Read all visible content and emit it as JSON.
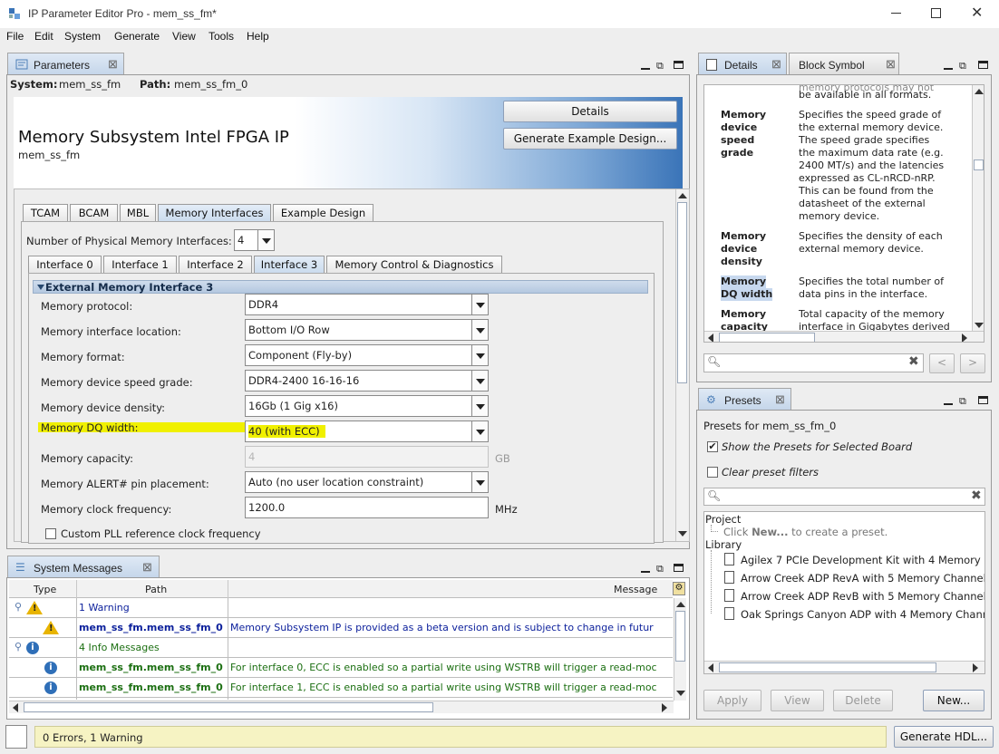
{
  "window": {
    "title": "IP Parameter Editor Pro - mem_ss_fm*"
  },
  "menu": [
    "File",
    "Edit",
    "System",
    "Generate",
    "View",
    "Tools",
    "Help"
  ],
  "parameters": {
    "tab_label": "Parameters",
    "system_label": "System:",
    "system_value": "mem_ss_fm",
    "path_label": "Path:",
    "path_value": "mem_ss_fm_0",
    "ip_title": "Memory Subsystem Intel FPGA IP",
    "ip_subtitle": "mem_ss_fm",
    "details_button": "Details",
    "generate_example_button": "Generate Example Design...",
    "tabs": [
      "TCAM",
      "BCAM",
      "MBL",
      "Memory Interfaces",
      "Example Design"
    ],
    "num_interfaces_label": "Number of Physical Memory Interfaces:",
    "num_interfaces_value": "4",
    "interface_tabs": [
      "Interface 0",
      "Interface 1",
      "Interface 2",
      "Interface 3",
      "Memory Control & Diagnostics"
    ],
    "section_title": "External Memory Interface 3",
    "fields": [
      {
        "label": "Memory protocol:",
        "value": "DDR4"
      },
      {
        "label": "Memory interface location:",
        "value": "Bottom I/O Row"
      },
      {
        "label": "Memory format:",
        "value": "Component (Fly-by)"
      },
      {
        "label": "Memory device speed grade:",
        "value": "DDR4-2400 16-16-16"
      },
      {
        "label": "Memory device density:",
        "value": "16Gb (1 Gig x16)"
      },
      {
        "label": "Memory DQ width:",
        "value": "40 (with ECC)"
      },
      {
        "label": "Memory capacity:",
        "value": "4",
        "unit": "GB"
      },
      {
        "label": "Memory ALERT# pin placement:",
        "value": "Auto (no user location constraint)"
      },
      {
        "label": "Memory clock frequency:",
        "value": "1200.0",
        "unit": "MHz"
      }
    ],
    "custom_pll_label": "Custom PLL reference clock frequency",
    "highlight_color": "#f0f000"
  },
  "details": {
    "tab_details": "Details",
    "tab_block_symbol": "Block Symbol",
    "top_fragment_1": "memory protocols may not",
    "top_fragment_2": "be available in all formats.",
    "entries": [
      {
        "term": [
          "Memory",
          "device",
          "speed",
          "grade"
        ],
        "desc": [
          "Specifies the speed grade of",
          "the external memory device.",
          "The speed grade specifies",
          "the maximum data rate (e.g.",
          "2400 MT/s) and the latencies",
          "expressed as CL-nRCD-nRP.",
          "This can be found from the",
          "datasheet of the external",
          "memory device."
        ]
      },
      {
        "term": [
          "Memory",
          "device",
          "density"
        ],
        "desc": [
          "Specifies the density of each",
          "external memory device."
        ]
      },
      {
        "term": [
          "Memory",
          "DQ width"
        ],
        "desc": [
          "Specifies the total number of",
          "data pins in the interface."
        ]
      },
      {
        "term": [
          "Memory",
          "capacity"
        ],
        "desc": [
          "Total capacity of the memory",
          "interface in Gigabytes derived"
        ]
      }
    ]
  },
  "presets": {
    "tab_label": "Presets",
    "presets_for": "Presets for mem_ss_fm_0",
    "show_presets_label": "Show the Presets for Selected Board",
    "clear_filters_label": "Clear preset filters",
    "project_label": "Project",
    "project_hint_pre": "Click ",
    "project_hint_bold": "New...",
    "project_hint_post": " to create a preset.",
    "library_label": "Library",
    "library_items": [
      "Agilex 7 PCIe Development Kit with 4 Memory C",
      "Arrow Creek ADP RevA with 5 Memory Channels",
      "Arrow Creek ADP RevB with 5 Memory Channels",
      "Oak Springs Canyon ADP with 4 Memory Chann"
    ],
    "buttons": {
      "apply": "Apply",
      "view": "View",
      "delete": "Delete",
      "new": "New..."
    }
  },
  "messages": {
    "tab_label": "System Messages",
    "col_type": "Type",
    "col_path": "Path",
    "col_message": "Message",
    "warning_group": "1 Warning",
    "info_group": "4 Info Messages",
    "rows": [
      {
        "path": "mem_ss_fm.mem_ss_fm_0",
        "message": "Memory Subsystem IP is provided as a beta version and is subject to change in futur"
      },
      {
        "path": "mem_ss_fm.mem_ss_fm_0",
        "message": "For interface 0, ECC is enabled so a partial write using WSTRB will trigger a read-moc"
      },
      {
        "path": "mem_ss_fm.mem_ss_fm_0",
        "message": "For interface 1, ECC is enabled so a partial write using WSTRB will trigger a read-moc"
      }
    ]
  },
  "status": {
    "text": "0 Errors, 1 Warning",
    "generate_hdl": "Generate HDL..."
  },
  "colors": {
    "accent": "#3a74b8",
    "warning_path": "#0b1f9b",
    "info_path": "#1c6f12",
    "status_bg": "#f6f3c3"
  }
}
